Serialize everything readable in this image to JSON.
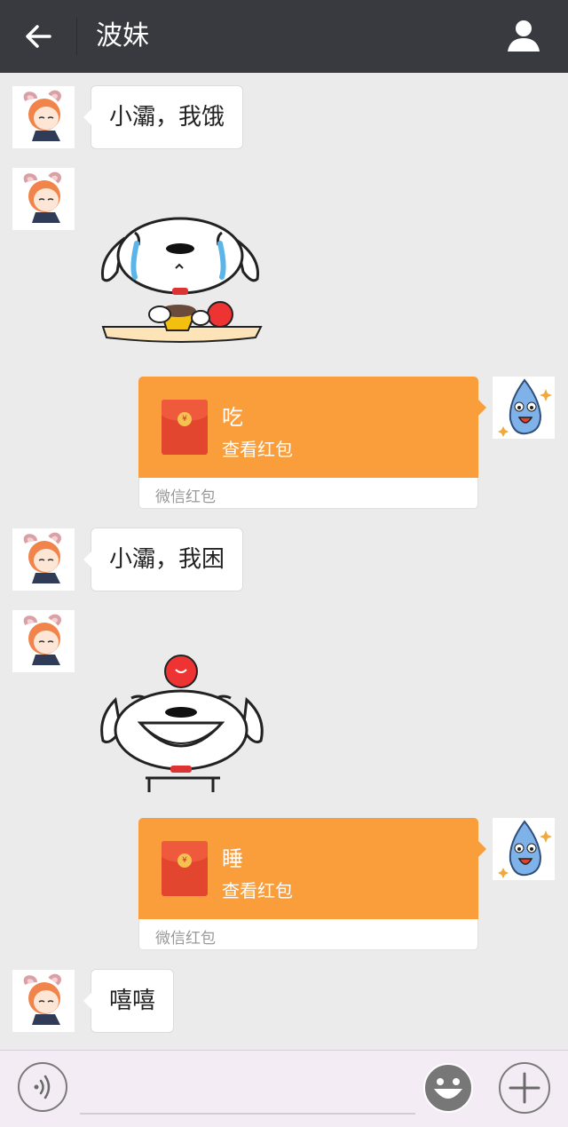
{
  "header": {
    "title": "波妹",
    "back_icon": "arrow-left-icon",
    "profile_icon": "person-icon"
  },
  "messages": [
    {
      "type": "text",
      "side": "left",
      "text": "小灞，我饿"
    },
    {
      "type": "sticker",
      "side": "left",
      "sticker": "crying-dog-eating"
    },
    {
      "type": "redpacket",
      "side": "right",
      "title": "吃",
      "action": "查看红包",
      "footer": "微信红包"
    },
    {
      "type": "text",
      "side": "left",
      "text": "小灞，我困"
    },
    {
      "type": "sticker",
      "side": "left",
      "sticker": "laughing-dog"
    },
    {
      "type": "redpacket",
      "side": "right",
      "title": "睡",
      "action": "查看红包",
      "footer": "微信红包"
    },
    {
      "type": "text",
      "side": "left",
      "text": "嘻嘻"
    }
  ],
  "input_bar": {
    "voice_icon": "voice-icon",
    "text_value": "",
    "emoji_icon": "smiley-icon",
    "plus_icon": "plus-icon"
  },
  "colors": {
    "header_bg": "#393a3f",
    "chat_bg": "#ebebeb",
    "redpacket": "#fa9d3b",
    "envelope": "#e2462f"
  }
}
